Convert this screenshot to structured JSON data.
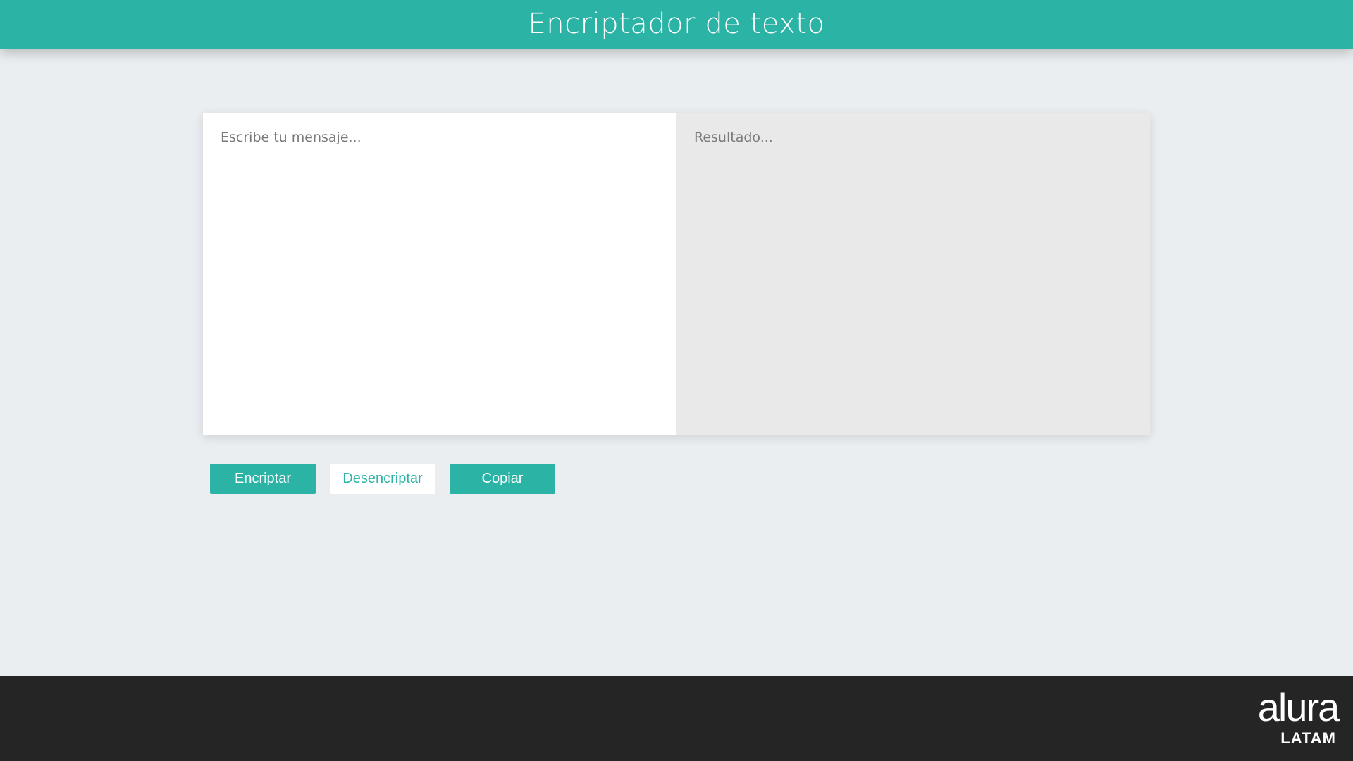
{
  "header": {
    "title": "Encriptador de texto"
  },
  "editor": {
    "input_placeholder": "Escribe tu mensaje...",
    "output_placeholder": "Resultado..."
  },
  "buttons": {
    "encrypt_label": "Encriptar",
    "decrypt_label": "Desencriptar",
    "copy_label": "Copiar"
  },
  "footer": {
    "logo_name": "alura",
    "logo_sub": "LATAM"
  },
  "colors": {
    "accent": "#2bb3a6",
    "background": "#eaeef1",
    "footer": "#252525",
    "output_panel": "#e9e9e9"
  }
}
